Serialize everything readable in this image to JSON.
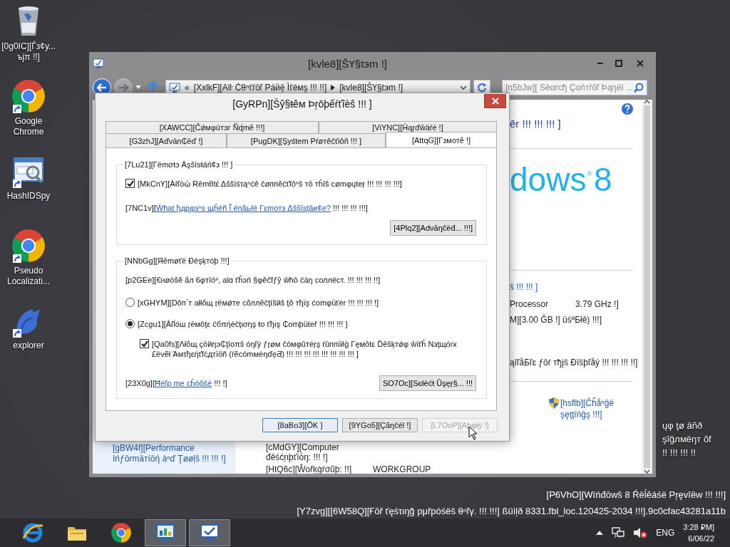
{
  "desktop_icons": [
    {
      "label": "[0g0IC][Ѓз¢у... ъjπ !!]",
      "kind": "recycle-bin"
    },
    {
      "label": "Google Chrome",
      "kind": "chrome"
    },
    {
      "label": "HashIDSpy",
      "kind": "hashid"
    },
    {
      "label": "Pseudo Localizati...",
      "kind": "chrome"
    },
    {
      "label": "explorer",
      "kind": "explorer"
    }
  ],
  "system_window": {
    "title": "[kvle8][ŜҮ§tэm !]",
    "address": {
      "overflow_mark": "«",
      "crumbs": [
        "[XxlkF][Alŀ Ċθⁿťŕōľ Ρáйē̦ Ìťéмş !!! !!]",
        "[kvle8][ŜҮ§tэm !]"
      ]
    },
    "search": {
      "placeholder": "[n5bJw][ Sēαrcђ Çоńтŕōľ Þąŋёl ..."
    },
    "sidebar": {
      "link": "[gBW4f][Performance Іńƒōrmāтíōή àⁿď Ţøøļš !!! !!! !]"
    },
    "content": {
      "heading": "ēr !!! !!! !!! ]",
      "logo": {
        "text": "dows",
        "mark": "®",
        "version": "8"
      },
      "rows": [
        {
          "kind": "link",
          "text": "š !!! !!! ]"
        },
        {
          "kind": "pair",
          "label": "Processor",
          "value": "3.79 GHz !]"
        },
        {
          "kind": "text",
          "text": "M][3.00 ĞB !] ūśªБłě) !!!]"
        },
        {
          "kind": "text",
          "text": "ąïľåБľɛ ƒōŕ тђįŝ Ðïŝþľåý !!! !!! !!! !!]"
        }
      ],
      "change_settings": "[hsflb][Ĉĥåⁿĝë şęţţïńĝş !!!]",
      "details": [
        {
          "label": "[cMdGY][Computer đěśćŗιþťïόŋ: !!! !]"
        },
        {
          "label": "[HtQ6c][Ŵořķġŕσũþ: !!]",
          "value": "WORKGROUP"
        }
      ]
    }
  },
  "desktop_text_fragments": [
    "ųφ ţø äñð",
    "şîĝлмëŋт õf",
    "!! !!! !!! !!"
  ],
  "dialog": {
    "title": "[GyRPn][Ŝŷ§ŧêм Þŗōþếŕťîèŝ !!! ]",
    "tab_rows": [
      [
        {
          "label": "[XAWCC][Ĉǿмφúтэг Ñɖmĕ !!!]",
          "selected": false
        },
        {
          "label": "[ViYNC][Ĥąŗďŵäŕė !]",
          "selected": false
        }
      ],
      [
        {
          "label": "[G3zhJ][Aďvän₵ëď !]",
          "selected": false
        },
        {
          "label": "[PugDK][Şуśtem Pŕøтêčťiôň !!! ]",
          "selected": false
        },
        {
          "label": "[AttqG][Γзмотĕ !]",
          "selected": true
        }
      ]
    ],
    "remote_assistance": {
      "title": "[7Lu21][Γëmσŧэ Āşšïsŧáń¢з !!! ]",
      "allow": {
        "label": "[MkCnY][Àℓľòώ Rēmθtέ Δŝŝìśτąⁿćê čøппĕćťĭōⁿŝ тō тĥîŝ cømφųteŗ !!! !!! !!! !!!]",
        "checked": true
      },
      "help": {
        "prefix": "[7NC1v][",
        "link": "Ŵħat ђдрφзⁿs щĥéñ Ĩ éпåьℓé Γεmотз Δŝŝīsţāи¢e?",
        "suffix": " !!! !!! !!! !!!]"
      },
      "button": "[4Plq2][Adνāŋĉёđ... !!!]"
    },
    "remote_desktop": {
      "title": "[NNbGg][Яēmøťë Ðéşķтóþ !!!]",
      "intro": "[p2GEe][€нøòŝĕ ẩл 6φтïóⁿ, alɑ ťĥэń §φêĉĭƒŷ ŵħō čàŋ ϲоллёст. !!! !!! !!! !!]",
      "options": [
        {
          "label": "[xGHYM][Dôп΄т аłłõщ ŗёмǿтe сõллĕčţíŝйš ţô тђïş ćomφüťėr !!! !!! !!! !]",
          "selected": false
        },
        {
          "label": "[Zcgu1][Âľĺóш ŗëмôţε ćбπήèčţισηş ŧо ťђış ₵omþüteř !!! !!! !!! ]",
          "selected": true
        }
      ],
      "nla": {
        "label": "[Qa0fs][Λłŏщ çòйŋэ₵ţïoπŝ óŋľý ƒŗøм ĉòмφûтéŗş ŕûппїйģ Γęмōtε Ďēŝķтǿφ ŵïťĥ Nзţщóгк £ëνĕł Άмτђεήťĭċдтїöñ (ŕĕcómмėŋďęƋ) !!! !!! !!! !!! !!! !!! !!! !!! ]",
        "checked": true
      },
      "help": {
        "prefix": "[23X0g][",
        "link": "Ħėľp me cĥòôŝé",
        "suffix": " !!! !]"
      },
      "button": "SO7Oc][Sєłèćŧ Ûşęŗ§... !!!"
    },
    "buttons": [
      {
        "label": "[8aBo3][ŎK ]",
        "default": true,
        "disabled": false
      },
      {
        "label": "[9YGo5][Çãŋčél !]",
        "default": false,
        "disabled": false
      },
      {
        "label": "[L7OoP][Aþφłý !]",
        "default": false,
        "disabled": true
      }
    ]
  },
  "build_info": [
    "[P6VhO][Wïńđōwŝ 8 Ŕēĺĕáśë Pŗęvîëw !!! !!!]",
    "[Y7zvg][[6W58Q][Ғōř ťęśτιŋğ pμřpóśëŝ θⁿľγ. !!! !!!] ßüìļð 8331.fbl_loc.120425-2034 !!!].9c0cfac43281a11b"
  ],
  "taskbar": {
    "apps": [
      {
        "kind": "ie",
        "active": false
      },
      {
        "kind": "folder",
        "active": false
      },
      {
        "kind": "chrome",
        "active": false
      },
      {
        "kind": "control-panel",
        "active": true
      },
      {
        "kind": "system",
        "active": true
      }
    ],
    "volume_muted": true,
    "language": "ENG",
    "time": "3:28 ₽M]",
    "date": "6/06/22"
  }
}
